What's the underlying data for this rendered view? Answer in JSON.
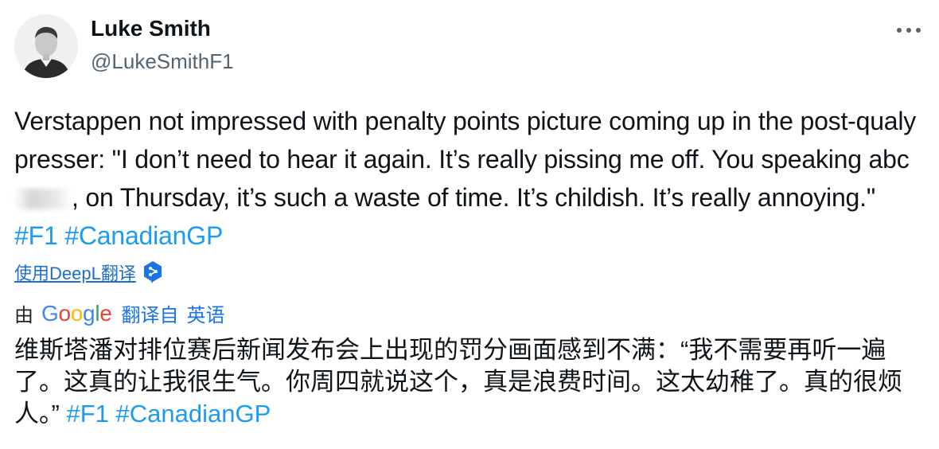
{
  "user": {
    "name": "Luke Smith",
    "handle": "@LukeSmithF1"
  },
  "tweet": {
    "text_part1": "Verstappen not impressed with penalty points picture coming up in the post-qualy presser: \"I don’t need to hear it again. It’s really pissing me off. You speaking abc",
    "text_part2": ", on Thursday, it’s such a waste of time. It’s childish. It’s really annoying.\"",
    "hashtags": [
      "#F1",
      "#CanadianGP"
    ]
  },
  "deepl": {
    "label": "使用DeepL翻译"
  },
  "google_translate": {
    "by_label": "由",
    "logo_letters": [
      "G",
      "o",
      "o",
      "g",
      "l",
      "e"
    ],
    "translated_from_label": "翻译自",
    "source_language": "英语"
  },
  "translation": {
    "text": "维斯塔潘对排位赛后新闻发布会上出现的罚分画面感到不满：“我不需要再听一遍了。这真的让我很生气。你周四就说这个，真是浪费时间。这太幼稚了。真的很烦人。”",
    "hashtags": [
      "#F1",
      "#CanadianGP"
    ]
  },
  "colors": {
    "hashtag": "#1d9bf0",
    "deepl_link": "#1d6fc7",
    "google_link": "#1a73e8",
    "handle": "#536471"
  },
  "icons": {
    "more": "more-horizontal-icon",
    "deepl": "deepl-icon"
  }
}
